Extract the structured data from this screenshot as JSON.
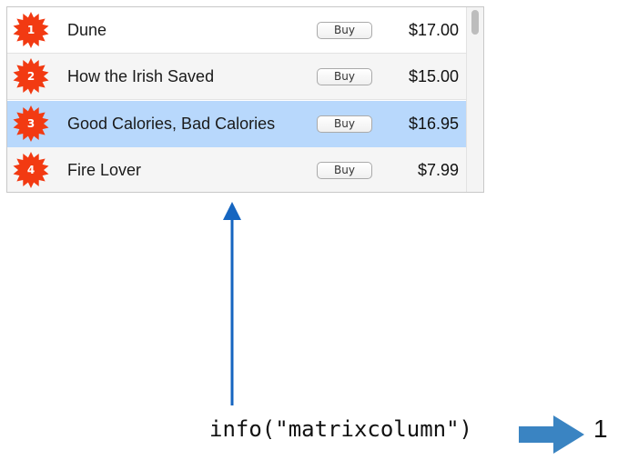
{
  "list": {
    "rows": [
      {
        "rank": "1",
        "title": "Dune",
        "buy_label": "Buy",
        "price": "$17.00",
        "selected": false
      },
      {
        "rank": "2",
        "title": "How the Irish Saved",
        "buy_label": "Buy",
        "price": "$15.00",
        "selected": false
      },
      {
        "rank": "3",
        "title": "Good Calories, Bad Calories",
        "buy_label": "Buy",
        "price": "$16.95",
        "selected": true
      },
      {
        "rank": "4",
        "title": "Fire Lover",
        "buy_label": "Buy",
        "price": "$7.99",
        "selected": false
      }
    ]
  },
  "annotation": {
    "code": "info(\"matrixcolumn\")",
    "result": "1"
  },
  "colors": {
    "badge": "#f23a12",
    "selection": "#b8d8fc",
    "arrow_up": "#1565c0",
    "arrow_right": "#3a84c2"
  },
  "icons": {
    "badge": "starburst-badge-icon",
    "scroll": "scrollbar-thumb"
  }
}
